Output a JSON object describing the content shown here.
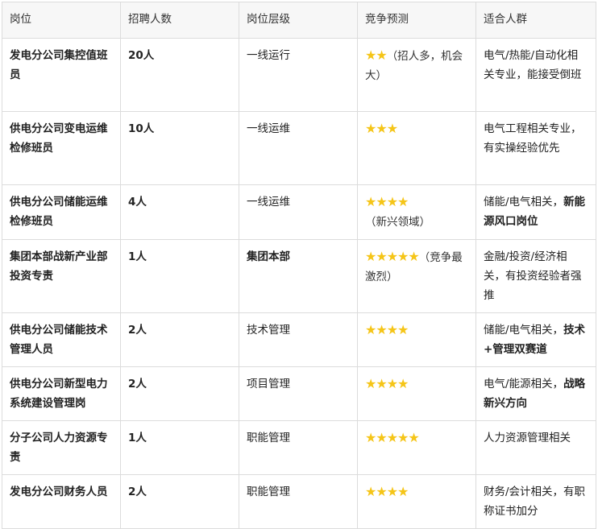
{
  "headers": [
    "岗位",
    "招聘人数",
    "岗位层级",
    "竞争预测",
    "适合人群"
  ],
  "colors": {
    "star": "#f5c518",
    "border": "#dcdcdc",
    "header_bg": "#f7f7f7"
  },
  "rows": [
    {
      "position": "发电分公司集控值班员",
      "count": "20人",
      "level": "一线运行",
      "level_bold": false,
      "stars": 2,
      "note": "（招人多，机会大）",
      "fit": [
        {
          "text": "电气/热能/自动化相关专业，能接受倒班",
          "bold": false
        }
      ]
    },
    {
      "position": "供电分公司变电运维检修班员",
      "count": "10人",
      "level": "一线运维",
      "level_bold": false,
      "stars": 3,
      "note": "",
      "fit": [
        {
          "text": "电气工程相关专业，有实操经验优先",
          "bold": false
        }
      ]
    },
    {
      "position": "供电分公司储能运维检修班员",
      "count": "4人",
      "level": "一线运维",
      "level_bold": false,
      "stars": 4,
      "note": "（新兴领域）",
      "fit": [
        {
          "text": "储能/电气相关，",
          "bold": false
        },
        {
          "text": "新能源风口岗位",
          "bold": true
        }
      ]
    },
    {
      "position": "集团本部战新产业部投资专责",
      "count": "1人",
      "level": "集团本部",
      "level_bold": true,
      "stars": 5,
      "note": "（竞争最激烈）",
      "fit": [
        {
          "text": "金融/投资/经济相关，有投资经验者强推",
          "bold": false
        }
      ]
    },
    {
      "position": "供电分公司储能技术管理人员",
      "count": "2人",
      "level": "技术管理",
      "level_bold": false,
      "stars": 4,
      "note": "",
      "fit": [
        {
          "text": "储能/电气相关，",
          "bold": false
        },
        {
          "text": "技术+管理双赛道",
          "bold": true
        }
      ]
    },
    {
      "position": "供电分公司新型电力系统建设管理岗",
      "count": "2人",
      "level": "项目管理",
      "level_bold": false,
      "stars": 4,
      "note": "",
      "fit": [
        {
          "text": "电气/能源相关，",
          "bold": false
        },
        {
          "text": "战略新兴方向",
          "bold": true
        }
      ]
    },
    {
      "position": "分子公司人力资源专责",
      "count": "1人",
      "level": "职能管理",
      "level_bold": false,
      "stars": 5,
      "note": "",
      "fit": [
        {
          "text": "人力资源管理相关",
          "bold": false
        }
      ]
    },
    {
      "position": "发电分公司财务人员",
      "count": "2人",
      "level": "职能管理",
      "level_bold": false,
      "stars": 4,
      "note": "",
      "fit": [
        {
          "text": "财务/会计相关，有职称证书加分",
          "bold": false
        }
      ]
    }
  ]
}
